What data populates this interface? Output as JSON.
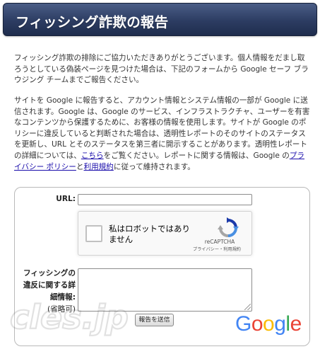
{
  "header": {
    "title": "フィッシング詐欺の報告"
  },
  "intro": {
    "p1": "フィッシング詐欺の排除にご協力いただきありがとうございます。個人情報をだまし取ろうとしている偽装ページを見つけた場合は、下記のフォームから Google セーフ ブラウジング チームまでご報告ください。",
    "p2_a": "サイトを Google に報告すると、アカウント情報とシステム情報の一部が Google に送信されます。Google は、Google のサービス、インフラストラクチャ、ユーザーを有害なコンテンツから保護するために、お客様の情報を使用します。サイトが Google のポリシーに違反していると判断された場合は、透明性レポートのそのサイトのステータスを更新し、URL とそのステータスを第三者に開示することがあります。透明性レポートの詳細については、",
    "p2_link_here": "こちら",
    "p2_b": "をご覧ください。レポートに関する情報は、Google の",
    "p2_link_privacy": "プライバシー ポリシー",
    "p2_c": "と",
    "p2_link_terms": "利用規約",
    "p2_d": "に従って維持されます。"
  },
  "form": {
    "url_label": "URL:",
    "url_value": "",
    "details_label": "フィッシングの違反に関する詳細情報:",
    "details_optional": "(省略可)",
    "details_value": "",
    "submit_label": "報告を送信"
  },
  "recaptcha": {
    "checkbox_label": "私はロボットではありません",
    "brand": "reCAPTCHA",
    "terms": "プライバシー・利用規約",
    "icon": "recaptcha-icon"
  },
  "google_logo": {
    "letters": [
      "G",
      "o",
      "o",
      "g",
      "l",
      "e"
    ],
    "colors": [
      "#4285F4",
      "#EA4335",
      "#FBBC05",
      "#4285F4",
      "#34A853",
      "#EA4335"
    ]
  },
  "watermark": {
    "text": "cles.jp"
  }
}
